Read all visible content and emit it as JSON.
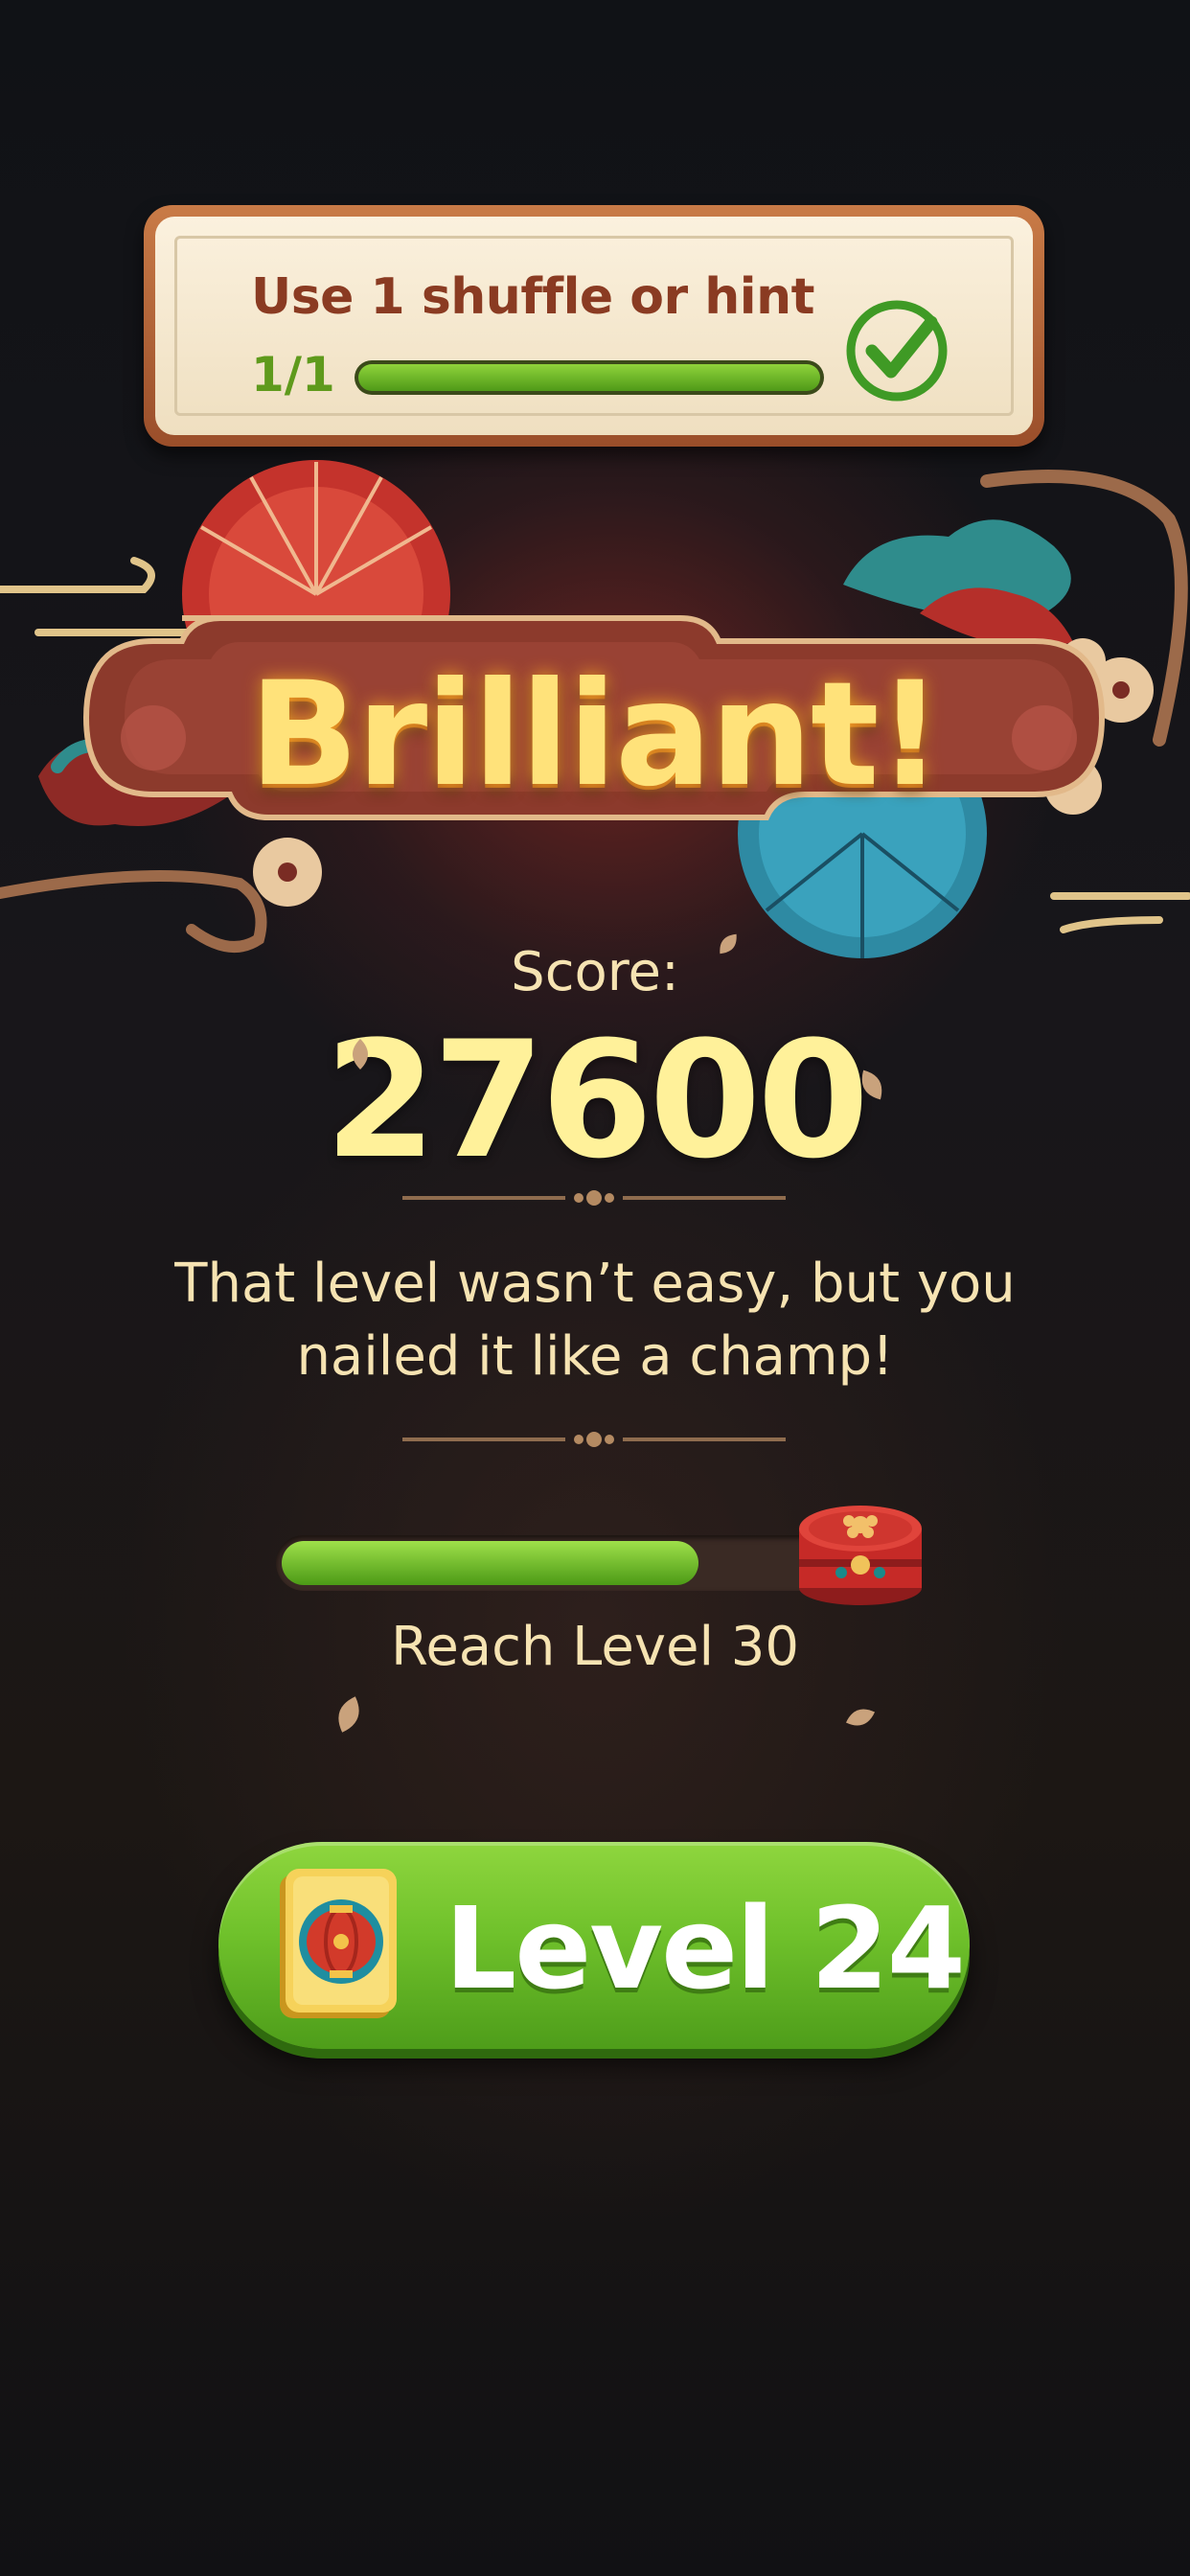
{
  "quest": {
    "title": "Use 1 shuffle or hint",
    "count": "1/1",
    "progress": 1.0,
    "completed": true
  },
  "banner": {
    "text": "Brilliant!"
  },
  "score": {
    "label": "Score:",
    "value": "27600"
  },
  "message": {
    "line1": "That level wasn’t easy, but you",
    "line2": "nailed it like a champ!"
  },
  "reward_progress": {
    "fraction": 0.74,
    "label": "Reach Level 30"
  },
  "next_level": {
    "label": "Level 24"
  },
  "colors": {
    "accent_gold": "#fff19a",
    "banner_red": "#8c3a2c",
    "button_green": "#6fc12b",
    "quest_text": "#8a3b22"
  },
  "icons": {
    "quest_check": "check-circle-icon",
    "reward": "gift-box-icon",
    "tile": "lantern-tile-icon"
  }
}
